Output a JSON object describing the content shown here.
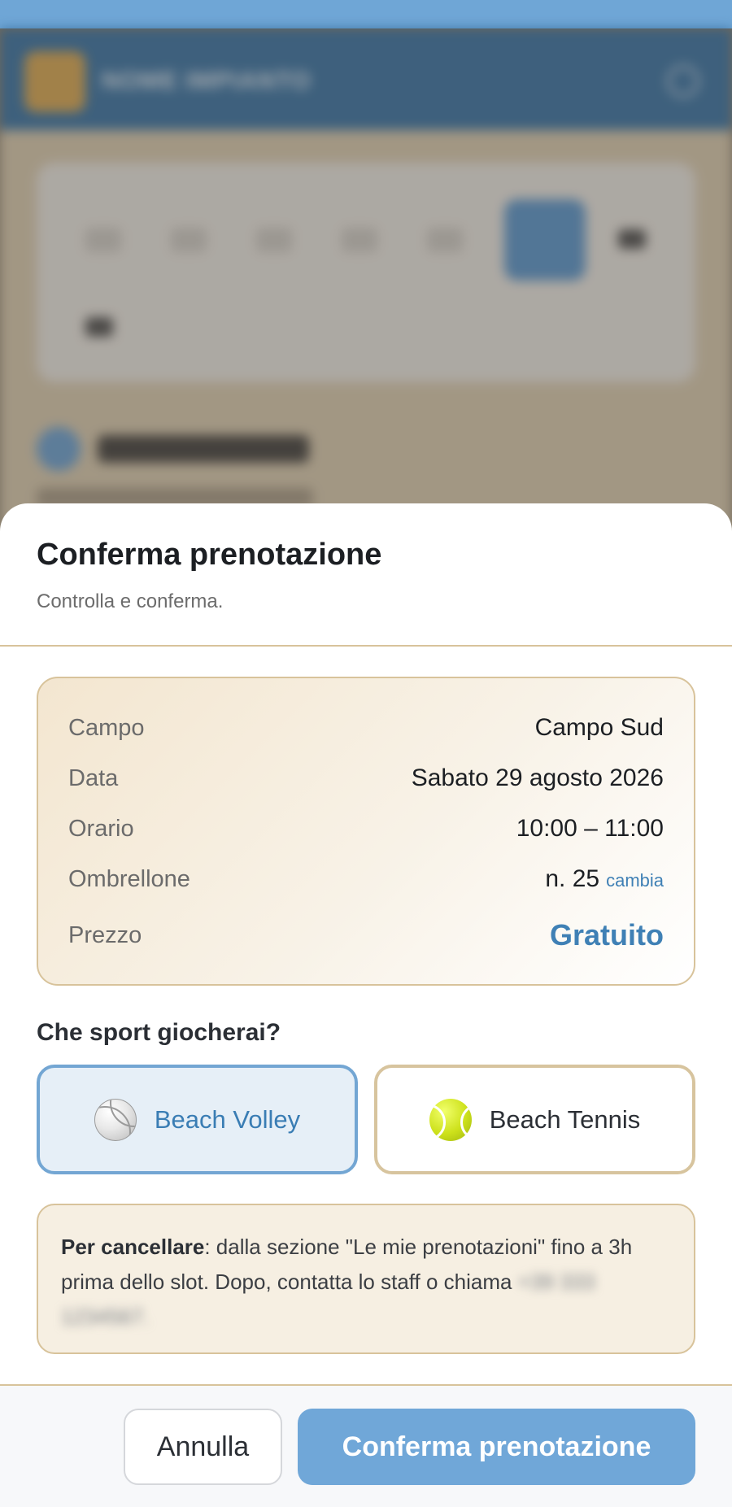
{
  "background": {
    "brand": "NOME IMPIANTO",
    "step_title": "Scegli un orario",
    "step_subtitle": "Sabato 29 agosto 2026"
  },
  "sheet": {
    "title": "Conferma prenotazione",
    "subtitle": "Controlla e conferma."
  },
  "summary": {
    "rows": [
      {
        "label": "Campo",
        "value": "Campo Sud"
      },
      {
        "label": "Data",
        "value": "Sabato 29 agosto 2026"
      },
      {
        "label": "Orario",
        "value": "10:00 – 11:00"
      },
      {
        "label": "Ombrellone",
        "value": "n. 25",
        "action": "cambia"
      },
      {
        "label": "Prezzo",
        "value": "Gratuito"
      }
    ]
  },
  "sport": {
    "question": "Che sport giocherai?",
    "options": [
      {
        "label": "Beach Volley",
        "icon": "volleyball-icon",
        "selected": true
      },
      {
        "label": "Beach Tennis",
        "icon": "tennis-ball-icon",
        "selected": false
      }
    ]
  },
  "notice": {
    "bold": "Per cancellare",
    "text": ": dalla sezione \"Le mie prenotazioni\" fino a 3h prima dello slot. Dopo, contatta lo staff o chiama",
    "redacted": " +39 333 1234567."
  },
  "footer": {
    "cancel_label": "Annulla",
    "confirm_label": "Conferma prenotazione"
  },
  "colors": {
    "accent": "#70a7d8",
    "accent_text": "#3f80b5",
    "border_sand": "#d8c39b",
    "selected_bg": "#e6eff7"
  }
}
